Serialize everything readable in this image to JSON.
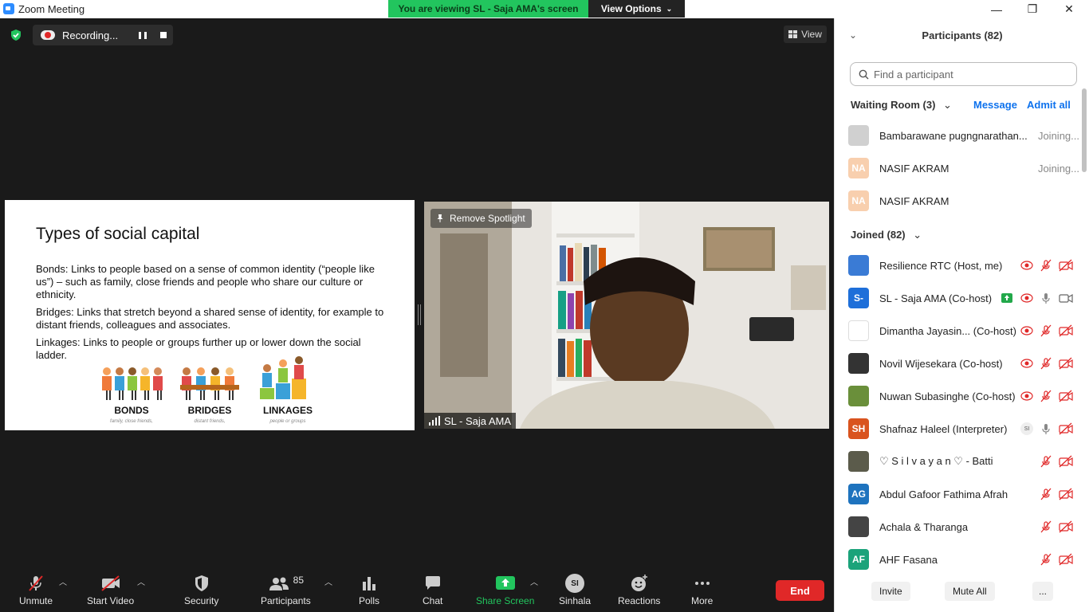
{
  "window": {
    "title": "Zoom Meeting",
    "minimize": "—",
    "maximize": "❐",
    "close": "✕"
  },
  "banner": {
    "viewing": "You are viewing SL - Saja AMA's screen",
    "view_options": "View Options"
  },
  "recording": {
    "label": "Recording..."
  },
  "view": {
    "label": "View"
  },
  "slide": {
    "title": "Types of social capital",
    "bonds": "Bonds: Links to people based on a sense of common identity (“people like us”) – such as family, close friends and people who share our culture or ethnicity.",
    "bridges": "Bridges: Links that stretch beyond a shared sense of identity, for example to distant friends, colleagues and associates.",
    "linkages": "Linkages: Links to people or groups further up or lower down the social ladder.",
    "figures": [
      {
        "caption": "BONDS",
        "sub": "family, close friends,"
      },
      {
        "caption": "BRIDGES",
        "sub": "distant friends,"
      },
      {
        "caption": "LINKAGES",
        "sub": "people or groups"
      }
    ]
  },
  "video": {
    "remove_spotlight": "Remove Spotlight",
    "name": "SL - Saja AMA"
  },
  "toolbar": {
    "unmute": "Unmute",
    "start_video": "Start Video",
    "security": "Security",
    "participants": "Participants",
    "participants_count": "85",
    "polls": "Polls",
    "chat": "Chat",
    "share_screen": "Share Screen",
    "language": "Sinhala",
    "language_abbr": "SI",
    "reactions": "Reactions",
    "more": "More",
    "end": "End"
  },
  "panel": {
    "title": "Participants (82)",
    "search_placeholder": "Find a participant",
    "waiting_room": "Waiting Room (3)",
    "message": "Message",
    "admit_all": "Admit all",
    "waiting": [
      {
        "name": "Bambarawane pugngnarathan...",
        "status": "Joining...",
        "initials": "",
        "color": "#d0d0d0"
      },
      {
        "name": "NASIF AKRAM",
        "status": "Joining...",
        "initials": "NA",
        "color": "#f8cfae"
      },
      {
        "name": "NASIF AKRAM",
        "status": "",
        "initials": "NA",
        "color": "#f8cfae"
      }
    ],
    "joined": "Joined (82)",
    "participants": [
      {
        "name": "Resilience RTC (Host, me)",
        "initials": "",
        "color": "#3a7bd5"
      },
      {
        "name": "SL - Saja AMA (Co-host)",
        "initials": "S-",
        "color": "#1e6fd9"
      },
      {
        "name": "Dimantha Jayasin...  (Co-host)",
        "initials": "",
        "color": "#ffffff"
      },
      {
        "name": "Novil Wijesekara (Co-host)",
        "initials": "",
        "color": "#333333"
      },
      {
        "name": "Nuwan Subasinghe (Co-host)",
        "initials": "",
        "color": "#6a8f3a"
      },
      {
        "name": "Shafnaz Haleel (Interpreter)",
        "initials": "SH",
        "color": "#d9531e"
      },
      {
        "name": "♡ S i l v a y a n ♡ - Batti",
        "initials": "",
        "color": "#5b5b4b"
      },
      {
        "name": "Abdul Gafoor Fathima Afrah",
        "initials": "AG",
        "color": "#1e73be"
      },
      {
        "name": "Achala & Tharanga",
        "initials": "",
        "color": "#444444"
      },
      {
        "name": "AHF Fasana",
        "initials": "AF",
        "color": "#1ba37a"
      }
    ],
    "interpreter_badge": "SI",
    "invite": "Invite",
    "mute_all": "Mute All",
    "more": "..."
  }
}
